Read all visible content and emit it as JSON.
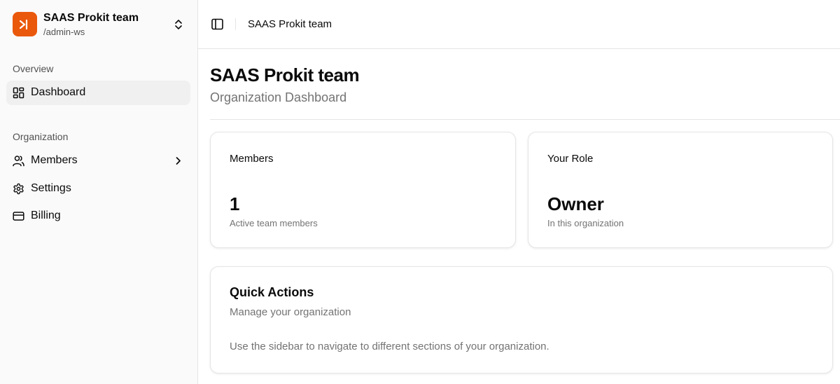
{
  "workspace": {
    "name": "SAAS Prokit team",
    "slug": "/admin-ws",
    "logo_icon": "terminal-icon",
    "brand_color": "#ea580c"
  },
  "sidebar": {
    "groups": [
      {
        "label": "Overview",
        "items": [
          {
            "label": "Dashboard",
            "icon": "layout-grid-icon",
            "active": true
          }
        ]
      },
      {
        "label": "Organization",
        "items": [
          {
            "label": "Members",
            "icon": "users-icon",
            "has_submenu": true
          },
          {
            "label": "Settings",
            "icon": "gear-icon"
          },
          {
            "label": "Billing",
            "icon": "credit-card-icon"
          }
        ]
      }
    ]
  },
  "topbar": {
    "toggle_icon": "sidebar-toggle-icon",
    "breadcrumb": "SAAS Prokit team"
  },
  "page": {
    "title": "SAAS Prokit team",
    "subtitle": "Organization Dashboard"
  },
  "stats": [
    {
      "label": "Members",
      "value": "1",
      "caption": "Active team members"
    },
    {
      "label": "Your Role",
      "value": "Owner",
      "caption": "In this organization"
    }
  ],
  "quick_actions": {
    "title": "Quick Actions",
    "description": "Manage your organization",
    "body": "Use the sidebar to navigate to different sections of your organization."
  }
}
